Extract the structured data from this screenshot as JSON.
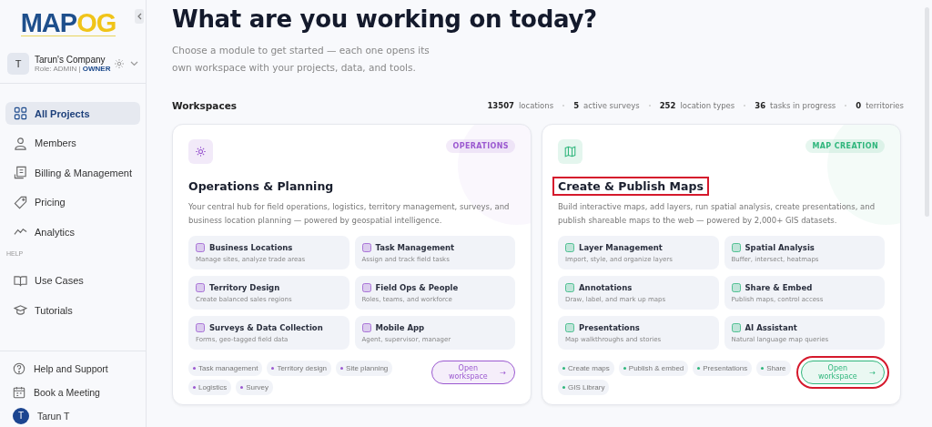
{
  "sidebar": {
    "logo": {
      "primary": "MAP",
      "accent": "OG"
    },
    "account": {
      "avatar": "T",
      "name": "Tarun's Company",
      "role": "Role: ADMIN |",
      "badge": "OWNER"
    },
    "items": [
      {
        "label": "All Projects",
        "selected": true
      },
      {
        "label": "Members",
        "selected": false
      },
      {
        "label": "Billing & Management",
        "selected": false
      },
      {
        "label": "Pricing",
        "selected": false
      },
      {
        "label": "Analytics",
        "selected": false
      }
    ],
    "help_heading": "HELP",
    "help_items": [
      {
        "label": "Use Cases",
        "selected": false
      },
      {
        "label": "Tutorials",
        "selected": false
      }
    ],
    "footer_items": [
      {
        "label": "Help and Support"
      },
      {
        "label": "Book a Meeting"
      }
    ],
    "user": {
      "avatar": "T",
      "name": "Tarun T"
    }
  },
  "header": {
    "title": "What are you working on today?",
    "subtitle": "Choose a module to get started — each one opens its own workspace with your projects, data, and tools."
  },
  "workspaces": {
    "heading": "Workspaces",
    "stats": [
      {
        "value": "13507",
        "label": "locations"
      },
      {
        "value": "5",
        "label": "active surveys"
      },
      {
        "value": "252",
        "label": "location types"
      },
      {
        "value": "36",
        "label": "tasks in progress"
      },
      {
        "value": "0",
        "label": "territories"
      }
    ],
    "cards": [
      {
        "badge": "OPERATIONS",
        "color": "#9b59d0",
        "title": "Operations & Planning",
        "title_highlighted": false,
        "description": "Your central hub for field operations, logistics, territory management, surveys, and business location planning — powered by geospatial intelligence.",
        "features": [
          {
            "title": "Business Locations",
            "subtitle": "Manage sites, analyze trade areas"
          },
          {
            "title": "Task Management",
            "subtitle": "Assign and track field tasks"
          },
          {
            "title": "Territory Design",
            "subtitle": "Create balanced sales regions"
          },
          {
            "title": "Field Ops & People",
            "subtitle": "Roles, teams, and workforce"
          },
          {
            "title": "Surveys & Data Collection",
            "subtitle": "Forms, geo-tagged field data"
          },
          {
            "title": "Mobile App",
            "subtitle": "Agent, supervisor, manager"
          }
        ],
        "tags": [
          "Task management",
          "Territory design",
          "Site planning",
          "Logistics",
          "Survey"
        ],
        "button": {
          "label": "Open workspace",
          "arrow": "→",
          "highlighted": false
        }
      },
      {
        "badge": "MAP CREATION",
        "color": "#2fb67c",
        "title": "Create & Publish Maps",
        "title_highlighted": true,
        "description": "Build interactive maps, add layers, run spatial analysis, create presentations, and publish shareable maps to the web — powered by 2,000+ GIS datasets.",
        "features": [
          {
            "title": "Layer Management",
            "subtitle": "Import, style, and organize layers"
          },
          {
            "title": "Spatial Analysis",
            "subtitle": "Buffer, intersect, heatmaps"
          },
          {
            "title": "Annotations",
            "subtitle": "Draw, label, and mark up maps"
          },
          {
            "title": "Share & Embed",
            "subtitle": "Publish maps, control access"
          },
          {
            "title": "Presentations",
            "subtitle": "Map walkthroughs and stories"
          },
          {
            "title": "AI Assistant",
            "subtitle": "Natural language map queries"
          }
        ],
        "tags": [
          "Create maps",
          "Publish & embed",
          "Presentations",
          "Share",
          "GIS Library"
        ],
        "button": {
          "label": "Open workspace",
          "arrow": "→",
          "highlighted": true
        }
      }
    ]
  }
}
